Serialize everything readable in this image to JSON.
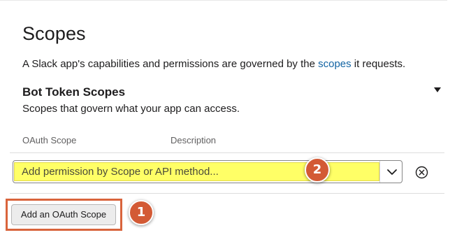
{
  "section": {
    "title": "Scopes",
    "description_prefix": "A Slack app's capabilities and permissions are governed by the ",
    "description_link": "scopes",
    "description_suffix": " it requests."
  },
  "bot_token_scopes": {
    "title": "Bot Token Scopes",
    "description": "Scopes that govern what your app can access.",
    "collapse_icon": "caret-down-icon"
  },
  "table": {
    "columns": [
      "OAuth Scope",
      "Description"
    ]
  },
  "scope_select": {
    "placeholder": "Add permission by Scope or API method...",
    "dropdown_icon": "chevron-down-icon",
    "clear_icon": "circle-x-icon"
  },
  "add_button": {
    "label": "Add an OAuth Scope"
  },
  "annotations": {
    "step_1": "1",
    "step_2": "2"
  },
  "colors": {
    "link": "#1264a3",
    "highlight": "#ffff66",
    "annotation": "#d9643c",
    "badge": "#d35a35"
  }
}
